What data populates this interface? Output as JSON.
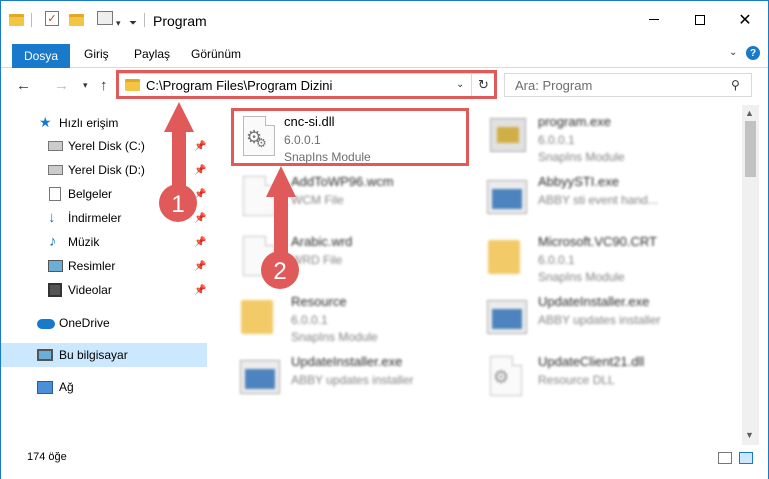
{
  "window": {
    "title": "Program",
    "minimize_glyph": "—",
    "maximize_glyph": "☐",
    "close_glyph": "✕"
  },
  "ribbon": {
    "tabs": [
      "Dosya",
      "Giriş",
      "Paylaş",
      "Görünüm"
    ],
    "help_glyph": "?"
  },
  "address_bar": {
    "path": "C:\\Program Files\\Program Dizini",
    "search_placeholder": "Ara: Program"
  },
  "sidebar": {
    "items": [
      {
        "label": "Hızlı erişim",
        "icon": "star-icon"
      },
      {
        "label": "Yerel Disk (C:)",
        "icon": "drive-icon",
        "pinned": true
      },
      {
        "label": "Yerel Disk (D:)",
        "icon": "drive-icon",
        "pinned": true
      },
      {
        "label": "Belgeler",
        "icon": "documents-icon",
        "pinned": true
      },
      {
        "label": "İndirmeler",
        "icon": "downloads-icon",
        "pinned": true
      },
      {
        "label": "Müzik",
        "icon": "music-icon",
        "pinned": true
      },
      {
        "label": "Resimler",
        "icon": "pictures-icon",
        "pinned": true
      },
      {
        "label": "Videolar",
        "icon": "videos-icon",
        "pinned": true
      },
      {
        "label": "OneDrive",
        "icon": "onedrive-icon"
      },
      {
        "label": "Bu bilgisayar",
        "icon": "this-pc-icon",
        "selected": true
      },
      {
        "label": "Ağ",
        "icon": "network-icon"
      }
    ]
  },
  "files": [
    {
      "name": "cnc-si.dll",
      "line1": "6.0.0.1",
      "line2": "SnapIns Module",
      "icon": "dll-gear-icon"
    },
    {
      "name": "program.exe",
      "line1": "6.0.0.1",
      "line2": "SnapIns Module",
      "icon": "program-exe-icon"
    },
    {
      "name": "AddToWP96.wcm",
      "line1": "WCM File",
      "line2": "",
      "icon": "document-icon"
    },
    {
      "name": "AbbyySTI.exe",
      "line1": "ABBY sti event hand...",
      "line2": "",
      "icon": "application-icon"
    },
    {
      "name": "Arabic.wrd",
      "line1": "WRD File",
      "line2": "",
      "icon": "document-icon"
    },
    {
      "name": "Microsoft.VC90.CRT",
      "line1": "6.0.0.1",
      "line2": "SnapIns Module",
      "icon": "folder-icon"
    },
    {
      "name": "Resource",
      "line1": "6.0.0.1",
      "line2": "SnapIns Module",
      "icon": "folder-icon"
    },
    {
      "name": "UpdateInstaller.exe",
      "line1": "ABBY updates installer",
      "line2": "",
      "icon": "application-icon"
    },
    {
      "name": "UpdateInstaller.exe",
      "line1": "ABBY updates installer",
      "line2": "",
      "icon": "application-icon"
    },
    {
      "name": "UpdateClient21.dll",
      "line1": "Resource DLL",
      "line2": "",
      "icon": "dll-gear-icon"
    }
  ],
  "status": {
    "item_count": "174 öğe"
  },
  "annotations": {
    "badge_1": "1",
    "badge_2": "2",
    "highlight_color": "#e05a5a",
    "badge_color": "#e05a5a"
  },
  "colors": {
    "accent": "#1979ca",
    "selection": "#cce8ff"
  }
}
